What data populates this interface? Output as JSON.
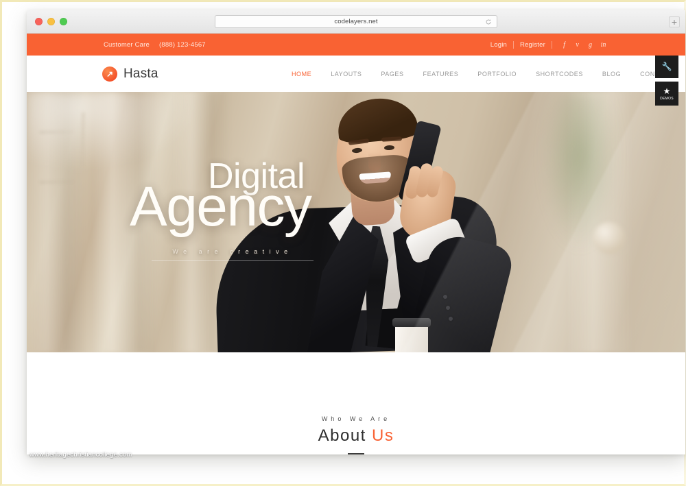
{
  "browser": {
    "url": "codelayers.net",
    "reload_icon": "reload-icon",
    "new_tab_label": "+",
    "traffic_lights": [
      "close",
      "minimize",
      "zoom"
    ]
  },
  "topbar": {
    "care_label": "Customer Care",
    "phone": "(888) 123-4567",
    "login_label": "Login",
    "register_label": "Register",
    "social": [
      {
        "name": "facebook-icon",
        "glyph": "f"
      },
      {
        "name": "twitter-icon",
        "glyph": "ᴠ"
      },
      {
        "name": "google-plus-icon",
        "glyph": "g"
      },
      {
        "name": "linkedin-icon",
        "glyph": "in"
      }
    ],
    "background_color": "#f96233"
  },
  "header": {
    "brand": "Hasta",
    "logo_icon": "arrow-up-right-icon",
    "nav": [
      {
        "label": "HOME",
        "active": true
      },
      {
        "label": "LAYOUTS",
        "active": false
      },
      {
        "label": "PAGES",
        "active": false
      },
      {
        "label": "FEATURES",
        "active": false
      },
      {
        "label": "PORTFOLIO",
        "active": false
      },
      {
        "label": "SHORTCODES",
        "active": false
      },
      {
        "label": "BLOG",
        "active": false
      },
      {
        "label": "CONTACT",
        "active": false
      }
    ],
    "side_buttons": [
      {
        "name": "settings-wrench-button",
        "glyph": "⚒",
        "caption": ""
      },
      {
        "name": "demos-button",
        "glyph": "★",
        "caption": "DEMOS"
      }
    ]
  },
  "hero": {
    "title_line1": "Digital",
    "title_line2": "Agency",
    "subtitle": "We are creative",
    "image_alt": "businessman-on-phone-photo"
  },
  "about": {
    "eyebrow": "Who We Are",
    "title_main": "About",
    "title_accent": "Us"
  },
  "watermark": {
    "text": "www.heritagechristiancollege.com"
  },
  "colors": {
    "accent": "#f96233",
    "dark_panel": "#1d1d1d",
    "nav_text": "#9a9a9a",
    "heading": "#2e2e2e"
  }
}
